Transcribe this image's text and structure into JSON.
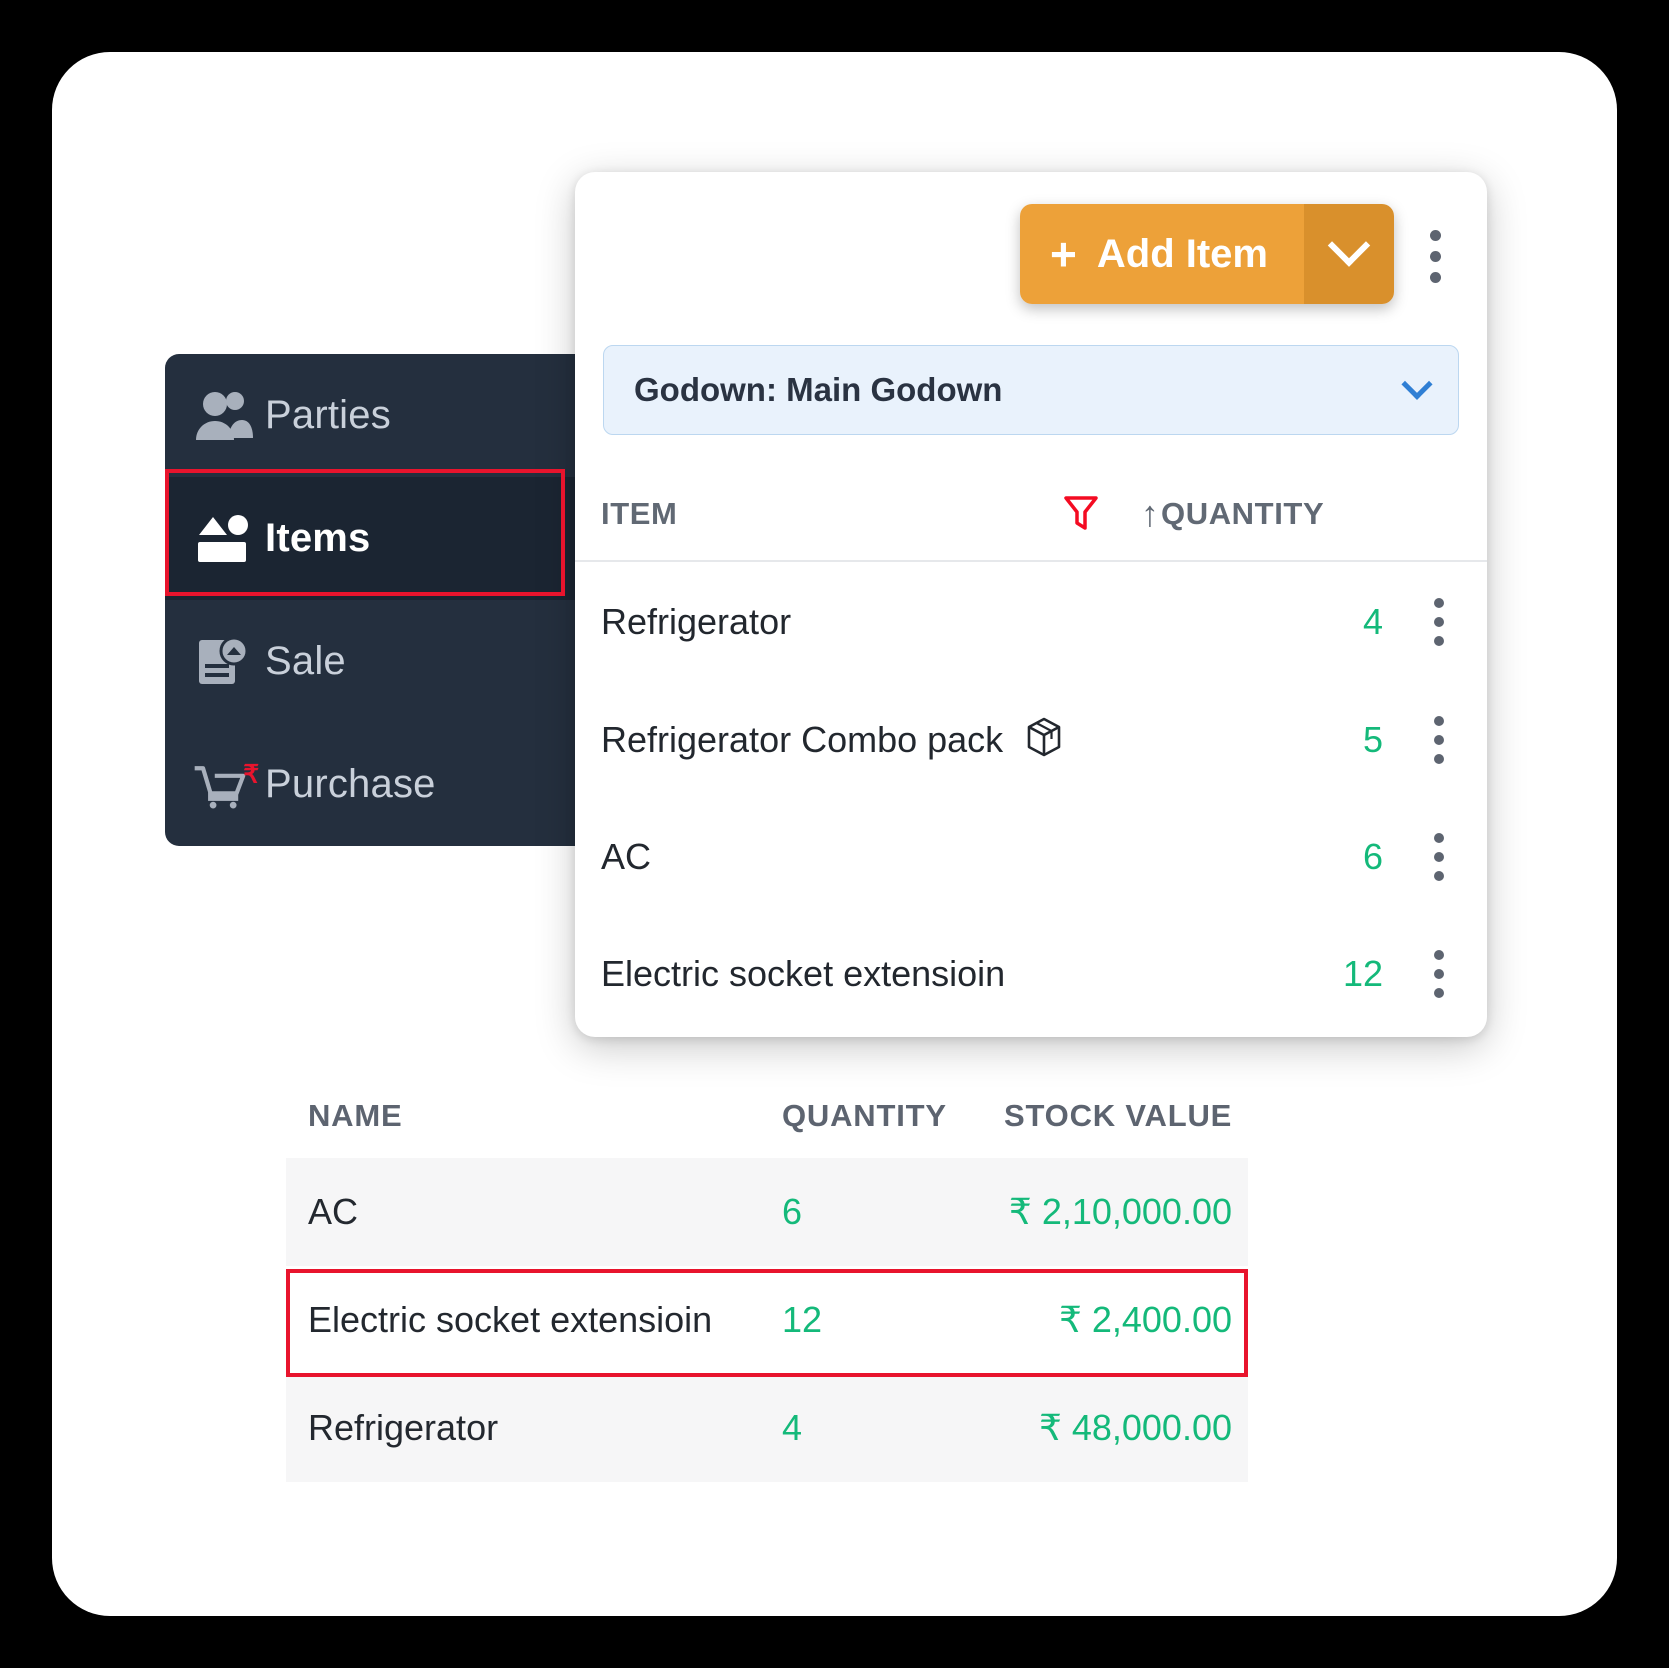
{
  "sidebar": {
    "items": [
      {
        "label": "Parties",
        "icon": "people-icon",
        "active": false
      },
      {
        "label": "Items",
        "icon": "items-box-icon",
        "active": true
      },
      {
        "label": "Sale",
        "icon": "sale-document-icon",
        "active": false
      },
      {
        "label": "Purchase",
        "icon": "purchase-cart-rupee-icon",
        "active": false
      }
    ]
  },
  "popup": {
    "add_item": {
      "label": "Add Item",
      "plus": "+",
      "caret_icon": "chevron-down-icon"
    },
    "kebab_icon": "more-vertical-icon",
    "godown": {
      "label": "Godown: Main Godown",
      "caret_icon": "chevron-down-icon"
    },
    "table": {
      "headers": {
        "item": "ITEM",
        "quantity": "QUANTITY",
        "filter_icon": "filter-icon",
        "sort_icon": "arrow-up-icon",
        "sort_glyph": "↑"
      },
      "rows": [
        {
          "name": "Refrigerator",
          "quantity": "4",
          "badge_icon": ""
        },
        {
          "name": "Refrigerator Combo pack",
          "quantity": "5",
          "badge_icon": "package-box-icon"
        },
        {
          "name": "AC",
          "quantity": "6",
          "badge_icon": ""
        },
        {
          "name": "Electric socket extensioin",
          "quantity": "12",
          "badge_icon": ""
        }
      ]
    }
  },
  "bottom_table": {
    "headers": {
      "name": "NAME",
      "quantity": "QUANTITY",
      "stock_value": "STOCK VALUE"
    },
    "rows": [
      {
        "name": "AC",
        "quantity": "6",
        "stock_value": "₹ 2,10,000.00",
        "highlighted": false
      },
      {
        "name": "Electric socket extensioin",
        "quantity": "12",
        "stock_value": "₹ 2,400.00",
        "highlighted": true
      },
      {
        "name": "Refrigerator",
        "quantity": "4",
        "stock_value": "₹ 48,000.00",
        "highlighted": false
      }
    ]
  },
  "colors": {
    "accent_orange": "#eda139",
    "accent_orange_dark": "#d9902c",
    "sidebar_bg": "#242f3e",
    "sidebar_active_bg": "#1b2532",
    "highlight_red": "#e8142d",
    "green": "#14b97a",
    "godown_blue_bg": "#e9f2fc"
  }
}
